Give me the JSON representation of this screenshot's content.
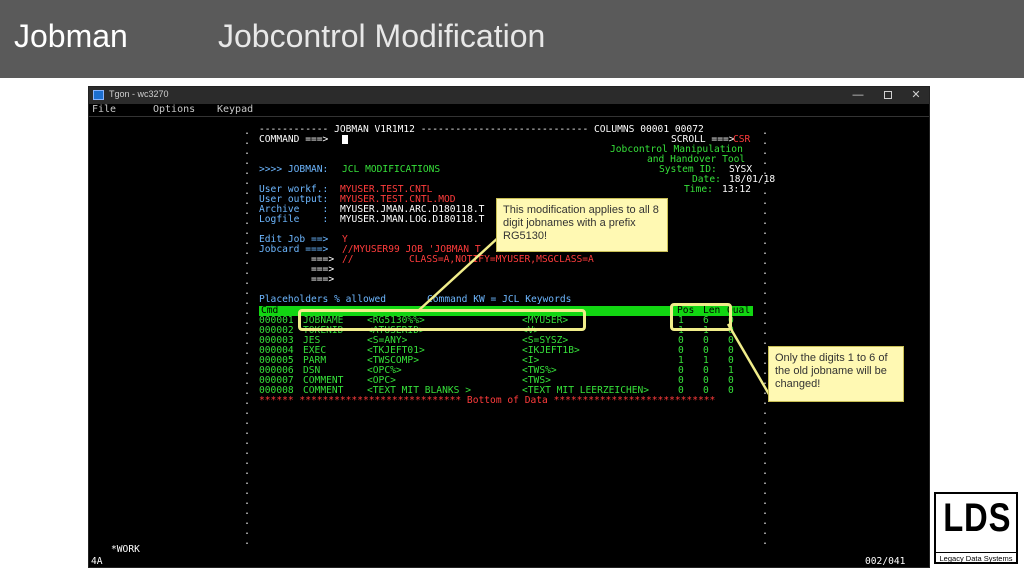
{
  "slide": {
    "brand": "Jobman",
    "title": "Jobcontrol Modification"
  },
  "window": {
    "title": "Tgon - wc3270",
    "menu": [
      "File",
      "Options",
      "Keypad"
    ],
    "min": "—",
    "close": "✕"
  },
  "terminal": {
    "line1_left": "------------ JOBMAN V1R1M12 ----------------------------- COLUMNS 00001 00072",
    "command_label": "COMMAND ===>",
    "scroll_label": "SCROLL ===>",
    "scroll_value": "CSR",
    "tool_line1": "Jobcontrol Manipulation",
    "tool_line2": "and Handover Tool",
    "system_label": "System ID:",
    "system_value": "SYSX",
    "date_label": "Date:",
    "date_value": "18/01/18",
    "time_label": "Time:",
    "time_value": "13:12",
    "jobman_label": ">>>> JOBMAN:",
    "jobman_value": "JCL MODIFICATIONS",
    "uw_label": "User workf.:",
    "uw_value": "MYUSER.TEST.CNTL",
    "uo_label": "User output:",
    "uo_value": "MYUSER.TEST.CNTL.MOD",
    "ar_label": "Archive    :",
    "ar_value": "MYUSER.JMAN.ARC.D180118.T",
    "lf_label": "Logfile    :",
    "lf_value": "MYUSER.JMAN.LOG.D180118.T",
    "edit_label": "Edit Job ==>",
    "edit_value": "Y",
    "jobcard_label": "Jobcard ===>",
    "jobcard_value1": "//MYUSER99 JOB 'JOBMAN T",
    "jobcard_arrow2": "===>",
    "jobcard_value2a": "//",
    "jobcard_value2b": "CLASS=A,NOTIFY=MYUSER,MSGCLASS=A",
    "arrow3": "===>",
    "arrow4": "===>",
    "placeholders": "Placeholders % allowed",
    "commandkw": "Command KW = JCL Keywords",
    "hdr_cmd": "Cmd",
    "hdr_pos": "Pos",
    "hdr_len": "Len",
    "hdr_qual": "Qual",
    "rows": [
      {
        "num": "000001",
        "kw": "JOBNAME",
        "old": "<RG5130%%>",
        "new": "<MYUSER>",
        "pos": "1",
        "len": "6",
        "qual": "0"
      },
      {
        "num": "000002",
        "kw": "TOKENID",
        "old": "<ATUSERID>",
        "new": "<V>",
        "pos": "1",
        "len": "1",
        "qual": "0"
      },
      {
        "num": "000003",
        "kw": "JES",
        "old": "<S=ANY>",
        "new": "<S=SYSZ>",
        "pos": "0",
        "len": "0",
        "qual": "0"
      },
      {
        "num": "000004",
        "kw": "EXEC",
        "old": "<TKJEFT01>",
        "new": "<IKJEFT1B>",
        "pos": "0",
        "len": "0",
        "qual": "0"
      },
      {
        "num": "000005",
        "kw": "PARM",
        "old": "<TWSCOMP>",
        "new": "<I>",
        "pos": "1",
        "len": "1",
        "qual": "0"
      },
      {
        "num": "000006",
        "kw": "DSN",
        "old": "<OPC%>",
        "new": "<TWS%>",
        "pos": "0",
        "len": "0",
        "qual": "1"
      },
      {
        "num": "000007",
        "kw": "COMMENT",
        "old": "<OPC>",
        "new": "<TWS>",
        "pos": "0",
        "len": "0",
        "qual": "0"
      },
      {
        "num": "000008",
        "kw": "COMMENT",
        "old": "<TEXT MIT BLANKS >",
        "new": "<TEXT MIT LEERZEICHEN>",
        "pos": "0",
        "len": "0",
        "qual": "0"
      }
    ],
    "bottom_line": "****** **************************** Bottom of Data ****************************",
    "status_left": "4A",
    "status_work": "*WORK",
    "status_right": "002/041"
  },
  "callouts": {
    "c1": "This modification applies to all 8 digit jobnames with a prefix RG5130!",
    "c2": "Only the digits 1 to 6 of the old jobname will be changed!"
  },
  "logo": {
    "big": "LDS",
    "small": "Legacy Data Systems"
  },
  "colors": {
    "header_bg": "#5a5a5a",
    "term_green": "#36e03a",
    "term_blue": "#6db7ff",
    "term_red": "#ff3c3c",
    "callout_bg": "#fff9b3",
    "highlight": "#f1ed8a"
  }
}
